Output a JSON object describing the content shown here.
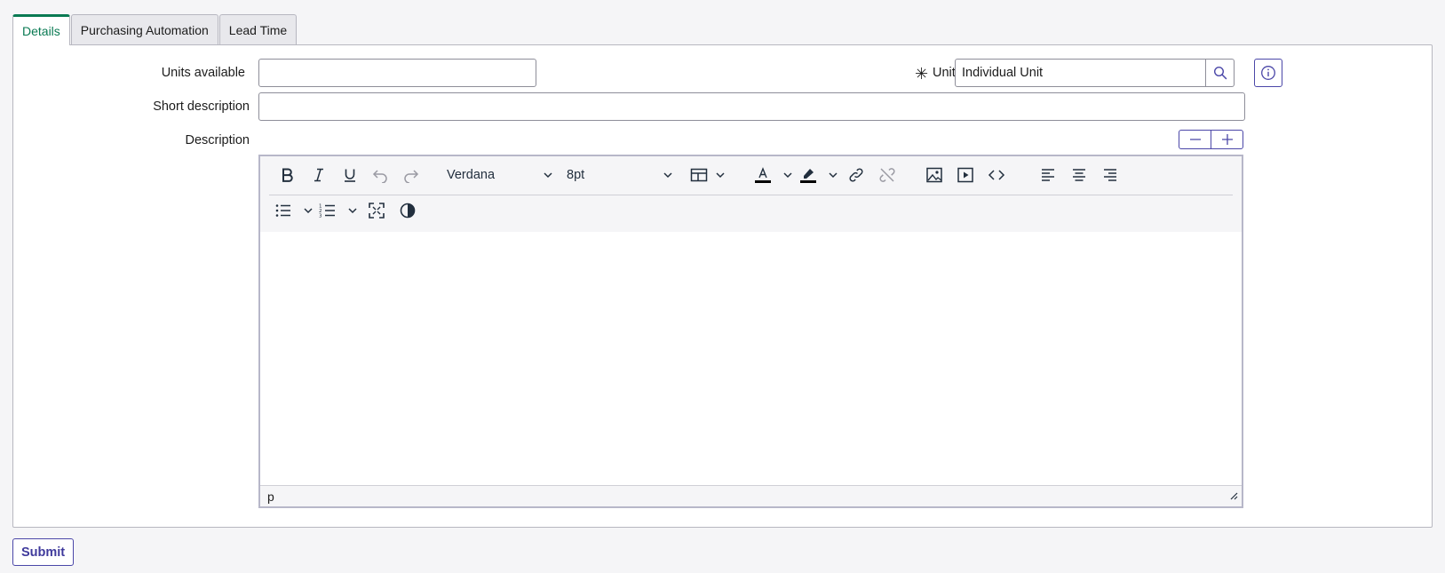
{
  "tabs": [
    {
      "label": "Details",
      "active": true
    },
    {
      "label": "Purchasing Automation",
      "active": false
    },
    {
      "label": "Lead Time",
      "active": false
    }
  ],
  "form": {
    "units_available": {
      "label": "Units available",
      "value": ""
    },
    "unit": {
      "label": "Unit",
      "required_marker": "✳",
      "value": "Individual Unit",
      "search_icon": "search-icon",
      "info_icon": "info-icon"
    },
    "short_description": {
      "label": "Short description",
      "value": ""
    },
    "description": {
      "label": "Description"
    }
  },
  "editor": {
    "font_family": "Verdana",
    "font_size": "8pt",
    "status_path": "p",
    "toolbar_icons": [
      "bold-icon",
      "italic-icon",
      "underline-icon",
      "undo-icon",
      "redo-icon",
      "table-icon",
      "text-color-icon",
      "highlight-color-icon",
      "link-icon",
      "unlink-icon",
      "image-icon",
      "media-icon",
      "code-icon",
      "align-left-icon",
      "align-center-icon",
      "align-right-icon",
      "bullet-list-icon",
      "numbered-list-icon",
      "fullscreen-icon",
      "contrast-icon"
    ],
    "accent_text_color": "#000000",
    "accent_highlight_color": "#000000"
  },
  "colors": {
    "accent_green": "#0a7a53",
    "accent_purple": "#4b47a8"
  },
  "submit_label": "Submit"
}
